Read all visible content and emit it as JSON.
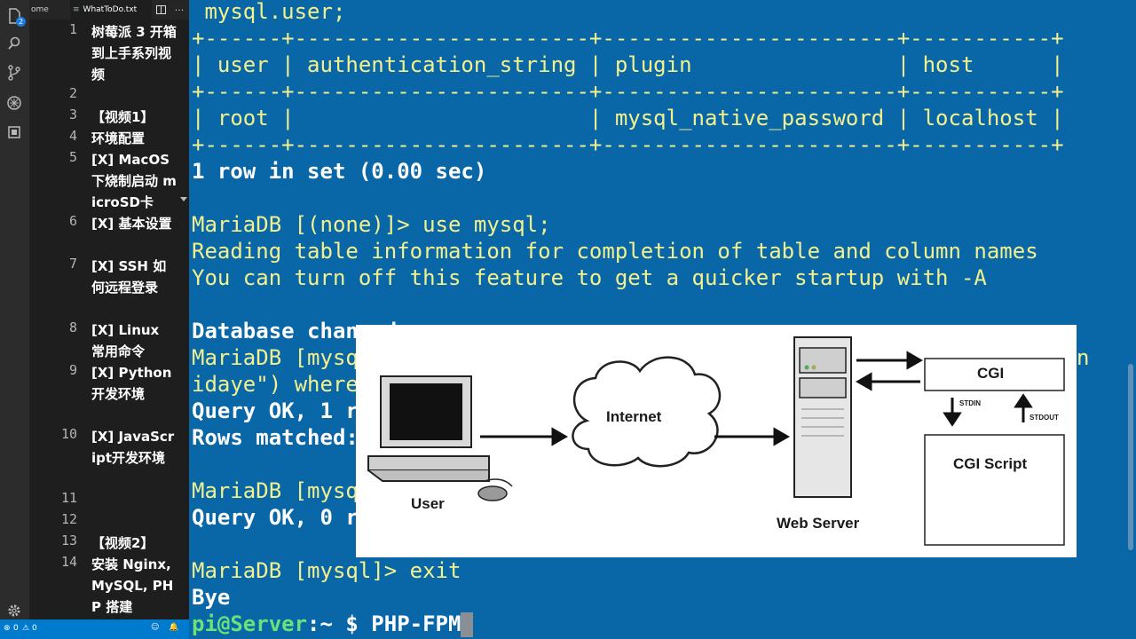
{
  "tabs": [
    {
      "label": "ome"
    },
    {
      "label": "WhatToDo.txt"
    }
  ],
  "activity_badge": "2",
  "editor_lines": [
    {
      "num": "1",
      "text": "树莓派 3 开箱到上手系列视频"
    },
    {
      "num": "2",
      "text": ""
    },
    {
      "num": "3",
      "text": "【视频1】"
    },
    {
      "num": "4",
      "text": "环境配置"
    },
    {
      "num": "5",
      "text": "[X] MacOS 下烧制启动 microSD卡"
    },
    {
      "num": "6",
      "text": "[X] 基本设置"
    },
    {
      "num": "7",
      "text": "[X] SSH 如何远程登录"
    },
    {
      "num": "8",
      "text": "[X] Linux 常用命令"
    },
    {
      "num": "9",
      "text": "[X] Python开发环境"
    },
    {
      "num": "10",
      "text": "[X] JavaScript开发环境"
    },
    {
      "num": "11",
      "text": ""
    },
    {
      "num": "12",
      "text": ""
    },
    {
      "num": "13",
      "text": "【视频2】"
    },
    {
      "num": "14",
      "text": "安装 Nginx, MySQL, PHP 搭建"
    }
  ],
  "status": {
    "errors": "0",
    "warnings": "0"
  },
  "terminal": {
    "lines": [
      {
        "text": " mysql.user;",
        "style": "y"
      },
      {
        "text": "+------+-----------------------+-----------------------+-----------+",
        "style": "y"
      },
      {
        "text": "| user | authentication_string | plugin                | host      |",
        "style": "y"
      },
      {
        "text": "+------+-----------------------+-----------------------+-----------+",
        "style": "y"
      },
      {
        "text": "| root |                       | mysql_native_password | localhost |",
        "style": "y"
      },
      {
        "text": "+------+-----------------------+-----------------------+-----------+",
        "style": "y"
      },
      {
        "text": "1 row in set (0.00 sec)",
        "style": "w"
      },
      {
        "text": "",
        "style": "y"
      },
      {
        "text": "MariaDB [(none)]> use mysql;",
        "style": "y"
      },
      {
        "text": "Reading table information for completion of table and column names",
        "style": "y"
      },
      {
        "text": "You can turn off this feature to get a quicker startup with -A",
        "style": "y"
      },
      {
        "text": "",
        "style": "y"
      },
      {
        "text": "Database changed",
        "style": "w"
      },
      {
        "text": "MariaDB [mysql]>                                                   hin",
        "style": "y"
      },
      {
        "text": "idaye\") where",
        "style": "y"
      },
      {
        "text": "Query OK, 1 r",
        "style": "w"
      },
      {
        "text": "Rows matched:",
        "style": "w"
      },
      {
        "text": "",
        "style": "y"
      },
      {
        "text": "MariaDB [mysql]>",
        "style": "y"
      },
      {
        "text": "Query OK, 0 r",
        "style": "w"
      },
      {
        "text": "",
        "style": "y"
      },
      {
        "text": "MariaDB [mysql]> exit",
        "style": "y"
      },
      {
        "text": "Bye",
        "style": "w"
      }
    ],
    "prompt": {
      "user_host": "pi@Server",
      "path_sep": ":~ $ ",
      "command": "PHP-FPM"
    }
  },
  "diagram": {
    "user": "User",
    "internet": "Internet",
    "web_server": "Web Server",
    "cgi": "CGI",
    "stdin": "STDIN",
    "stdout": "STDOUT",
    "cgi_script": "CGI Script"
  }
}
